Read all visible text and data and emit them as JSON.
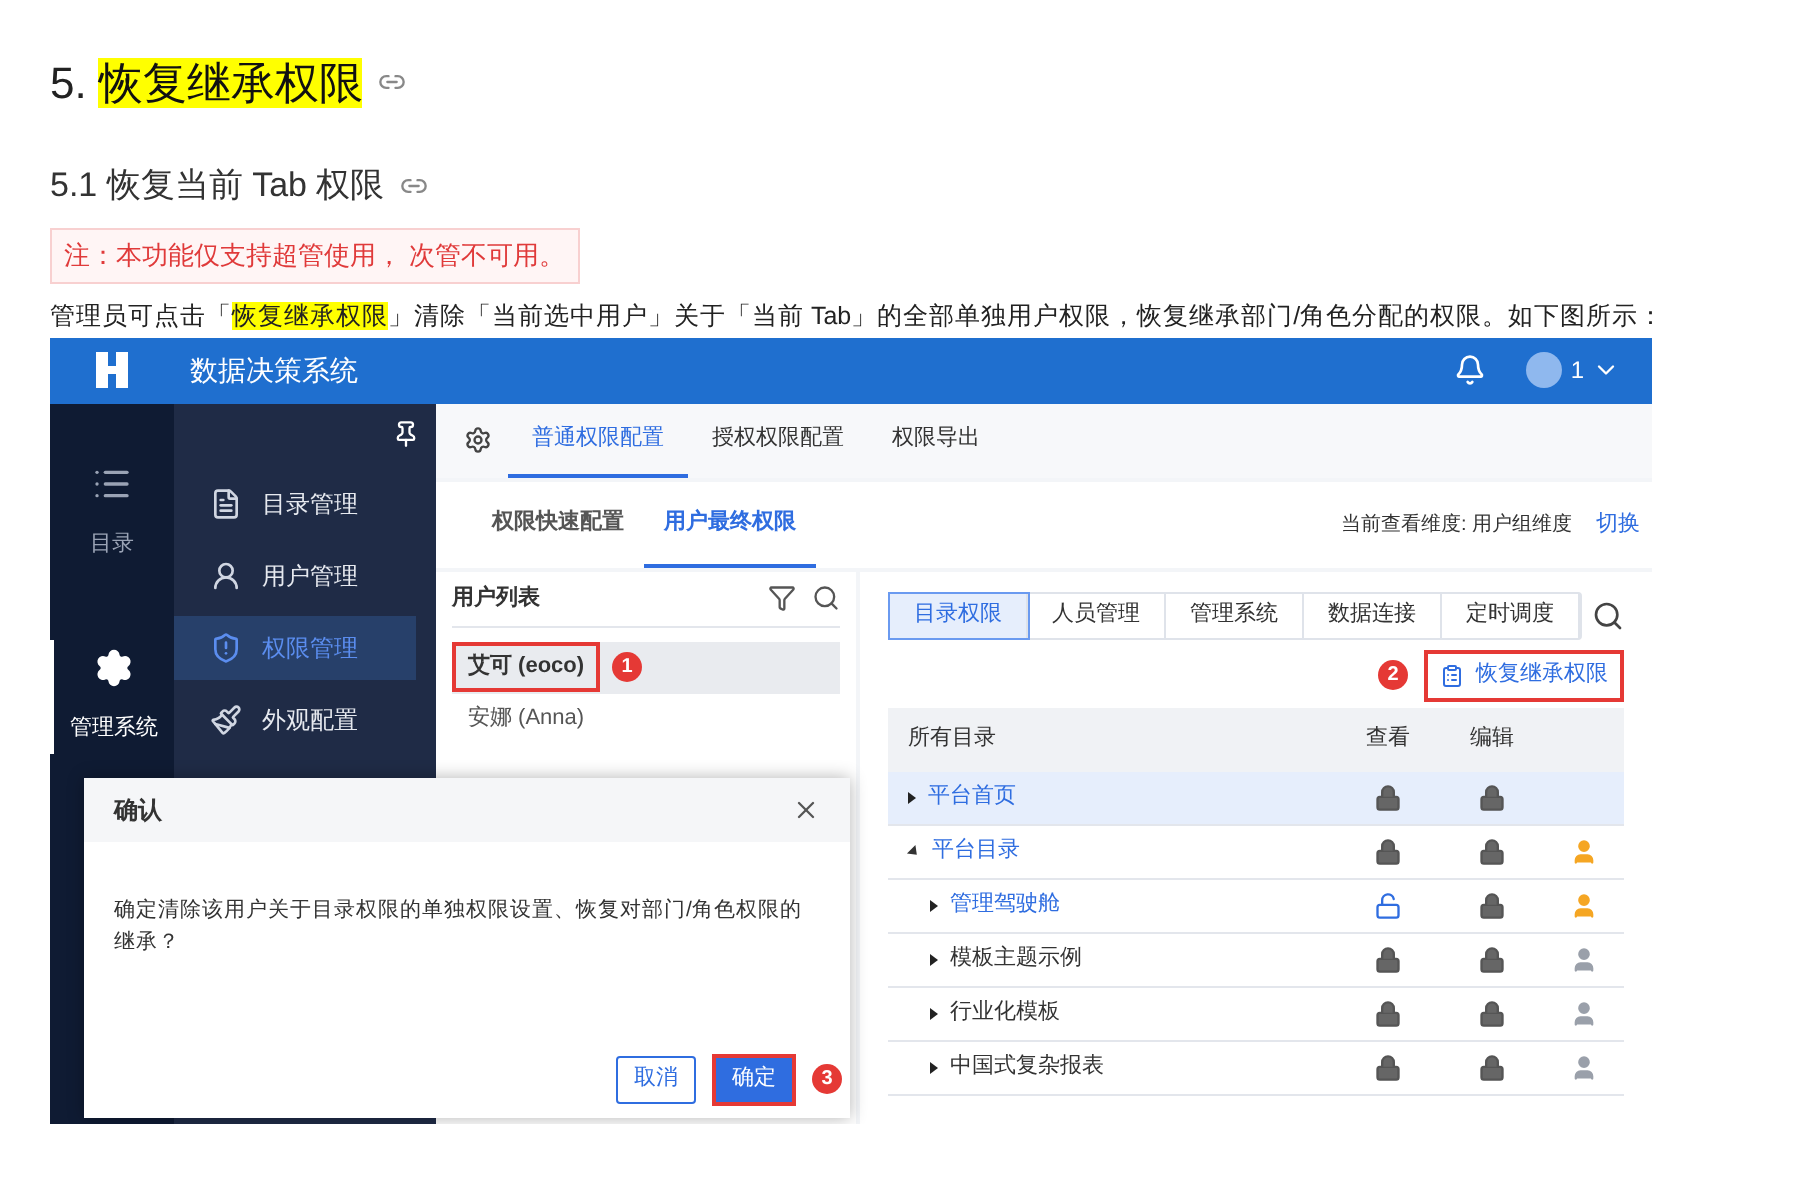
{
  "heading": {
    "number": "5.",
    "title": "恢复继承权限"
  },
  "subheading": "5.1 恢复当前 Tab 权限",
  "note": "注：本功能仅支持超管使用， 次管不可用。",
  "intro": {
    "before": "管理员可点击「",
    "highlight": "恢复继承权限",
    "after": "」清除「当前选中用户」关于「当前 Tab」的全部单独用户权限，恢复继承部门/角色分配的权限。如下图所示："
  },
  "app": {
    "title": "数据决策系统",
    "user_badge": "1",
    "rail": [
      {
        "label": "目录",
        "kind": "list",
        "selected": false
      },
      {
        "label": "管理系统",
        "kind": "gear",
        "selected": true
      }
    ],
    "menu": [
      {
        "label": "目录管理",
        "kind": "doc",
        "selected": false
      },
      {
        "label": "用户管理",
        "kind": "user",
        "selected": false
      },
      {
        "label": "权限管理",
        "kind": "shield",
        "selected": true
      },
      {
        "label": "外观配置",
        "kind": "brush",
        "selected": false
      }
    ],
    "tabs": [
      {
        "label": "普通权限配置",
        "selected": true
      },
      {
        "label": "授权权限配置",
        "selected": false
      },
      {
        "label": "权限导出",
        "selected": false
      }
    ],
    "subtabs": [
      {
        "label": "权限快速配置",
        "selected": false
      },
      {
        "label": "用户最终权限",
        "selected": true
      }
    ],
    "dimension_label": "当前查看维度: 用户组维度",
    "switch_link": "切换",
    "user_list": {
      "title": "用户列表",
      "users": [
        {
          "name": "艾可 (eoco)",
          "selected": true,
          "marker": "1"
        },
        {
          "name": "安娜 (Anna)",
          "selected": false
        }
      ]
    },
    "perm_tabs": [
      {
        "label": "目录权限",
        "selected": true
      },
      {
        "label": "人员管理",
        "selected": false
      },
      {
        "label": "管理系统",
        "selected": false
      },
      {
        "label": "数据连接",
        "selected": false
      },
      {
        "label": "定时调度",
        "selected": false
      }
    ],
    "restore_button": {
      "label": "恢复继承权限",
      "marker": "2"
    },
    "table": {
      "columns": [
        "所有目录",
        "查看",
        "编辑"
      ],
      "rows": [
        {
          "name": "平台首页",
          "selected": true,
          "modified": true,
          "expanded": false,
          "view_locked": true,
          "edit_locked": true,
          "kind": "plain",
          "children": []
        },
        {
          "name": "平台目录",
          "selected": false,
          "modified": true,
          "expanded": true,
          "view_locked": true,
          "edit_locked": true,
          "kind": "restore",
          "children": [
            {
              "name": "管理驾驶舱",
              "selected": false,
              "modified": true,
              "expanded": false,
              "view_locked": false,
              "edit_locked": true,
              "kind": "restore"
            },
            {
              "name": "模板主题示例",
              "selected": false,
              "modified": false,
              "expanded": false,
              "view_locked": true,
              "edit_locked": true,
              "kind": "inherited"
            },
            {
              "name": "行业化模板",
              "selected": false,
              "modified": false,
              "expanded": false,
              "view_locked": true,
              "edit_locked": true,
              "kind": "inherited"
            },
            {
              "name": "中国式复杂报表",
              "selected": false,
              "modified": false,
              "expanded": false,
              "view_locked": true,
              "edit_locked": true,
              "kind": "inherited"
            }
          ]
        }
      ]
    },
    "dialog": {
      "title": "确认",
      "message": "确定清除该用户关于目录权限的单独权限设置、恢复对部门/角色权限的继承？",
      "cancel": "取消",
      "confirm": "确定",
      "marker": "3"
    }
  }
}
